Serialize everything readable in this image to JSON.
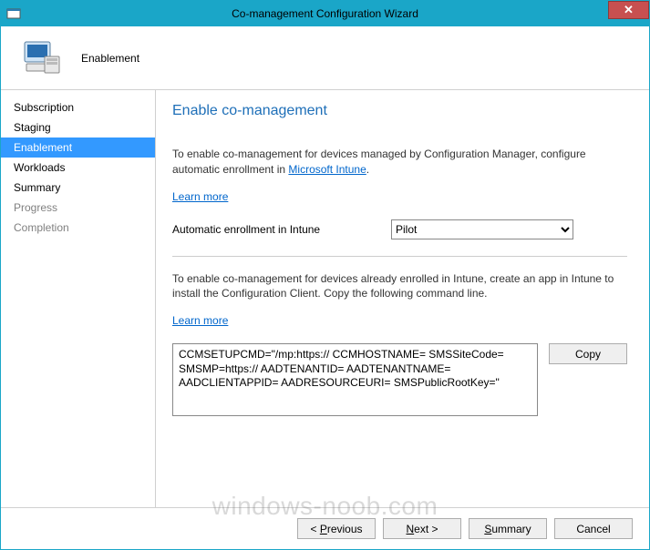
{
  "window": {
    "title": "Co-management Configuration Wizard",
    "close_symbol": "✕"
  },
  "header": {
    "title": "Enablement"
  },
  "sidebar": {
    "items": [
      {
        "label": "Subscription",
        "state": "done"
      },
      {
        "label": "Staging",
        "state": "done"
      },
      {
        "label": "Enablement",
        "state": "selected"
      },
      {
        "label": "Workloads",
        "state": "pending"
      },
      {
        "label": "Summary",
        "state": "pending"
      },
      {
        "label": "Progress",
        "state": "disabled"
      },
      {
        "label": "Completion",
        "state": "disabled"
      }
    ]
  },
  "content": {
    "page_title": "Enable co-management",
    "section1": {
      "desc_pre": "To enable co-management for devices managed by Configuration Manager, configure automatic enrollment in ",
      "desc_link": "Microsoft Intune",
      "desc_post": ".",
      "learn_more": "Learn more",
      "field_label": "Automatic enrollment in Intune",
      "field_value": "Pilot",
      "field_options": [
        "Pilot"
      ]
    },
    "section2": {
      "desc": "To enable co-management for devices already enrolled in Intune, create an app in Intune to install the Configuration Client. Copy the following command line.",
      "learn_more": "Learn more",
      "command": "CCMSETUPCMD=\"/mp:https:// CCMHOSTNAME= SMSSiteCode= SMSMP=https:// AADTENANTID= AADTENANTNAME= AADCLIENTAPPID= AADRESOURCEURI= SMSPublicRootKey=\"",
      "copy_label": "Copy"
    }
  },
  "footer": {
    "previous": "Previous",
    "next": "Next",
    "summary": "Summary",
    "cancel": "Cancel"
  },
  "watermark": "windows-noob.com"
}
